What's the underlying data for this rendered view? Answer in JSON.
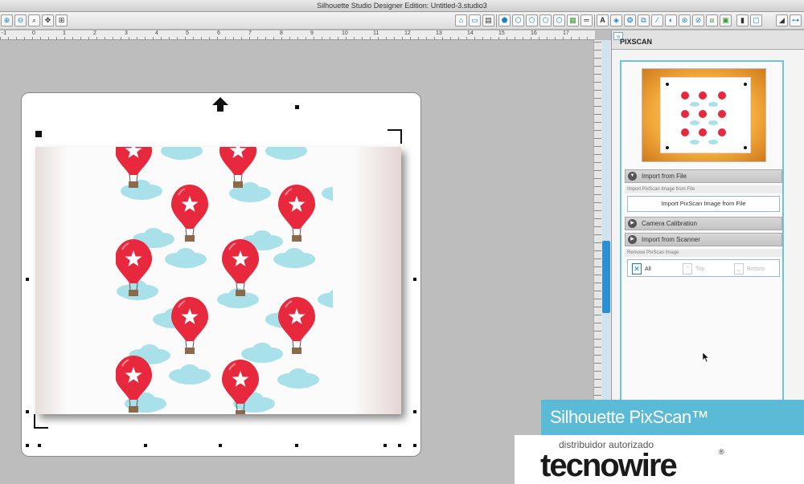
{
  "window": {
    "title": "Silhouette Studio Designer Edition: Untitled-3.studio3"
  },
  "ruler": {
    "labels": [
      "-1",
      "0",
      "1",
      "2",
      "3",
      "4",
      "5",
      "6",
      "7",
      "8",
      "9",
      "10",
      "11",
      "12",
      "13",
      "14",
      "15",
      "16",
      "17"
    ]
  },
  "toolbar": {
    "left_icons": [
      "zoom-in-icon",
      "zoom-out-icon",
      "zoom-selection-icon",
      "pan-icon",
      "fit-page-icon"
    ],
    "right_icons": [
      "page-setup-icon",
      "registration-marks-icon",
      "cut-settings-icon",
      "fill-color-icon",
      "line-color-icon",
      "line-style-icon",
      "gradient-icon",
      "pattern-icon",
      "shadow-icon",
      "text-icon",
      "trace-icon",
      "offset-icon",
      "replicate-icon",
      "modify-icon",
      "knife-icon",
      "transform-icon",
      "point-edit-icon",
      "layers-icon",
      "library-icon",
      "design-store-icon",
      "send-to-silhouette-icon"
    ]
  },
  "panel": {
    "collapse_glyph": "»",
    "title": "PIXSCAN",
    "import_file": "Import from File",
    "import_file_sublabel": "Import PixScan Image from File",
    "import_button": "Import PixScan Image from File",
    "camera": "Camera Calibration",
    "scanner": "Import from Scanner",
    "remove_sublabel": "Remove PixScan Image",
    "remove_all": "All",
    "remove_top": "Top",
    "remove_bottom": "Bottom"
  },
  "overlay": {
    "banner": "Silhouette PixScan™",
    "distributor": "distribuidor autorizado",
    "logo_part1": "tecno",
    "logo_part2": "wire",
    "registered": "®"
  },
  "colors": {
    "accent": "#5bbad5",
    "balloon": "#e8283c",
    "cloud": "#a9e1ea",
    "basket": "#8a6a4a",
    "logo_highlight": "#ffffff"
  }
}
